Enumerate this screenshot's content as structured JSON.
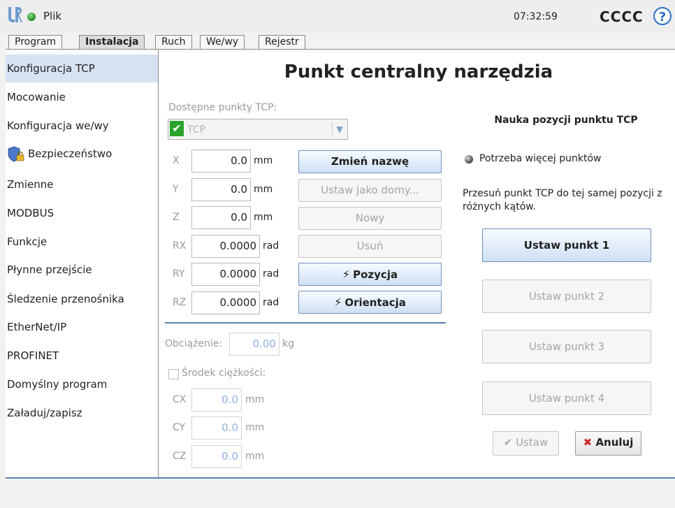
{
  "header": {
    "file_label": "Plik",
    "clock": "07:32:59",
    "robot_name": "CCCC",
    "help_icon": "?"
  },
  "tabs": [
    {
      "label": "Program",
      "active": false
    },
    {
      "label": "Instalacja",
      "active": true
    },
    {
      "label": "Ruch",
      "active": false
    },
    {
      "label": "We/wy",
      "active": false
    },
    {
      "label": "Rejestr",
      "active": false
    }
  ],
  "sidebar": {
    "items": [
      {
        "label": "Konfiguracja TCP",
        "selected": true
      },
      {
        "label": "Mocowanie"
      },
      {
        "label": "Konfiguracja we/wy"
      },
      {
        "label": "Bezpieczeństwo",
        "icon": "shield-lock-icon"
      },
      {
        "label": "Zmienne"
      },
      {
        "label": "MODBUS"
      },
      {
        "label": "Funkcje"
      },
      {
        "label": "Płynne przejście"
      },
      {
        "label": "Śledzenie przenośnika"
      },
      {
        "label": "EtherNet/IP"
      },
      {
        "label": "PROFINET"
      },
      {
        "label": "Domyślny program"
      },
      {
        "label": "Załaduj/zapisz"
      }
    ]
  },
  "main": {
    "title": "Punkt centralny narzędzia",
    "tcp_list_label": "Dostępne punkty TCP:",
    "tcp_selected": "TCP",
    "pose": [
      {
        "axis": "X",
        "value": "0.0",
        "unit": "mm"
      },
      {
        "axis": "Y",
        "value": "0.0",
        "unit": "mm"
      },
      {
        "axis": "Z",
        "value": "0.0",
        "unit": "mm"
      },
      {
        "axis": "RX",
        "value": "0.0000",
        "unit": "rad"
      },
      {
        "axis": "RY",
        "value": "0.0000",
        "unit": "rad"
      },
      {
        "axis": "RZ",
        "value": "0.0000",
        "unit": "rad"
      }
    ],
    "buttons": {
      "rename": "Zmień nazwę",
      "set_default": "Ustaw jako domy...",
      "new": "Nowy",
      "delete": "Usuń",
      "position": "Pozycja",
      "orientation": "Orientacja"
    },
    "payload_label": "Obciążenie:",
    "payload_value": "0.00",
    "payload_unit": "kg",
    "cog_label": "Środek ciężkości:",
    "cog": [
      {
        "axis": "CX",
        "value": "0.0",
        "unit": "mm"
      },
      {
        "axis": "CY",
        "value": "0.0",
        "unit": "mm"
      },
      {
        "axis": "CZ",
        "value": "0.0",
        "unit": "mm"
      }
    ]
  },
  "teach": {
    "title": "Nauka pozycji punktu TCP",
    "status": "Potrzeba więcej punktów",
    "instruction": "Przesuń punkt TCP do tej samej pozycji z różnych kątów.",
    "point_buttons": [
      "Ustaw punkt 1",
      "Ustaw punkt 2",
      "Ustaw punkt 3",
      "Ustaw punkt 4"
    ],
    "set_label": "Ustaw",
    "cancel_label": "Anuluj"
  },
  "colors": {
    "accent": "#5b7fae",
    "selected_bg": "#d6e3f3",
    "run_indicator": "#1d8a1d"
  }
}
